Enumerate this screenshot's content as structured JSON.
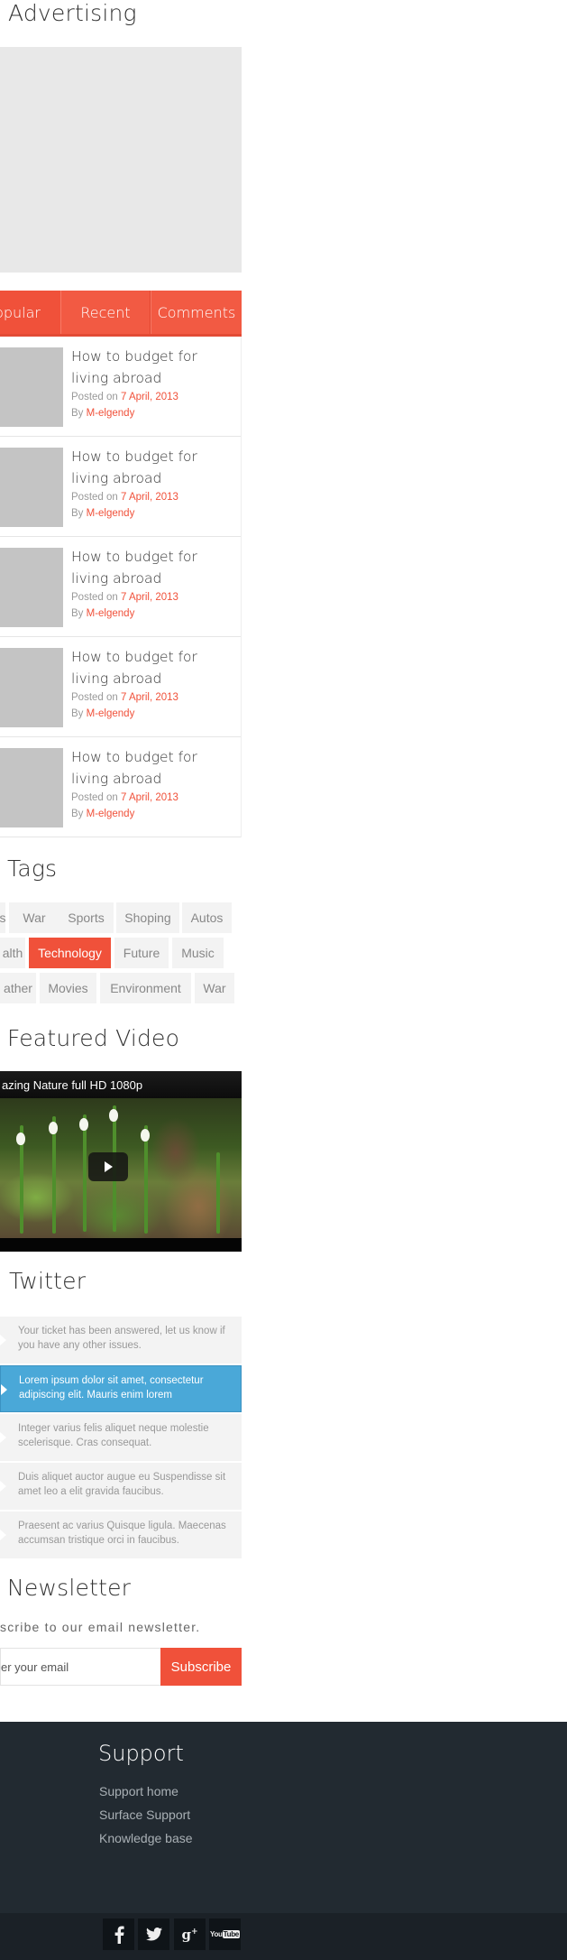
{
  "advertising": {
    "title": "Advertising"
  },
  "tabs": [
    {
      "label": "opular"
    },
    {
      "label": "Recent"
    },
    {
      "label": "Comments"
    }
  ],
  "posts": [
    {
      "title": "How to budget for living abroad",
      "posted_prefix": "Posted on",
      "date": "7 April, 2013",
      "by_prefix": "By",
      "author": "M-elgendy"
    },
    {
      "title": "How to budget for living abroad",
      "posted_prefix": "Posted on",
      "date": "7 April, 2013",
      "by_prefix": "By",
      "author": "M-elgendy"
    },
    {
      "title": "How to budget for living abroad",
      "posted_prefix": "Posted on",
      "date": "7 April, 2013",
      "by_prefix": "By",
      "author": "M-elgendy"
    },
    {
      "title": "How to budget for living abroad",
      "posted_prefix": "Posted on",
      "date": "7 April, 2013",
      "by_prefix": "By",
      "author": "M-elgendy"
    },
    {
      "title": "How to budget for living abroad",
      "posted_prefix": "Posted on",
      "date": "7 April, 2013",
      "by_prefix": "By",
      "author": "M-elgendy"
    }
  ],
  "tags": {
    "title": "Tags",
    "items": [
      "s",
      "War",
      "Sports",
      "Shoping",
      "Autos",
      "alth",
      "Technology",
      "Future",
      "Music",
      "ather",
      "Movies",
      "Environment",
      "War"
    ],
    "active": "Technology"
  },
  "video": {
    "title": "Featured Video",
    "caption": "azing Nature full HD 1080p"
  },
  "twitter": {
    "title": "Twitter",
    "tweets": [
      "Your ticket has been answered, let us know if you have any other issues.",
      "Lorem ipsum dolor sit amet, consectetur adipiscing elit. Mauris enim lorem",
      "Integer varius felis aliquet neque molestie scelerisque. Cras consequat.",
      "Duis aliquet auctor augue eu Suspendisse sit amet leo a elit gravida faucibus.",
      "Praesent ac varius Quisque ligula. Maecenas accumsan tristique orci in faucibus."
    ]
  },
  "newsletter": {
    "title": "Newsletter",
    "text": "scribe to our email newsletter.",
    "input_value": "er your email",
    "button": "Subscribe"
  },
  "support": {
    "title": "Support",
    "links": [
      "Support home",
      "Surface Support",
      "Knowledge base"
    ]
  },
  "social": [
    "facebook-icon",
    "twitter-icon",
    "google-plus-icon",
    "youtube-icon"
  ],
  "colors": {
    "accent": "#f0513a",
    "tweet_active": "#4aa8d8",
    "footer": "#222a31"
  }
}
